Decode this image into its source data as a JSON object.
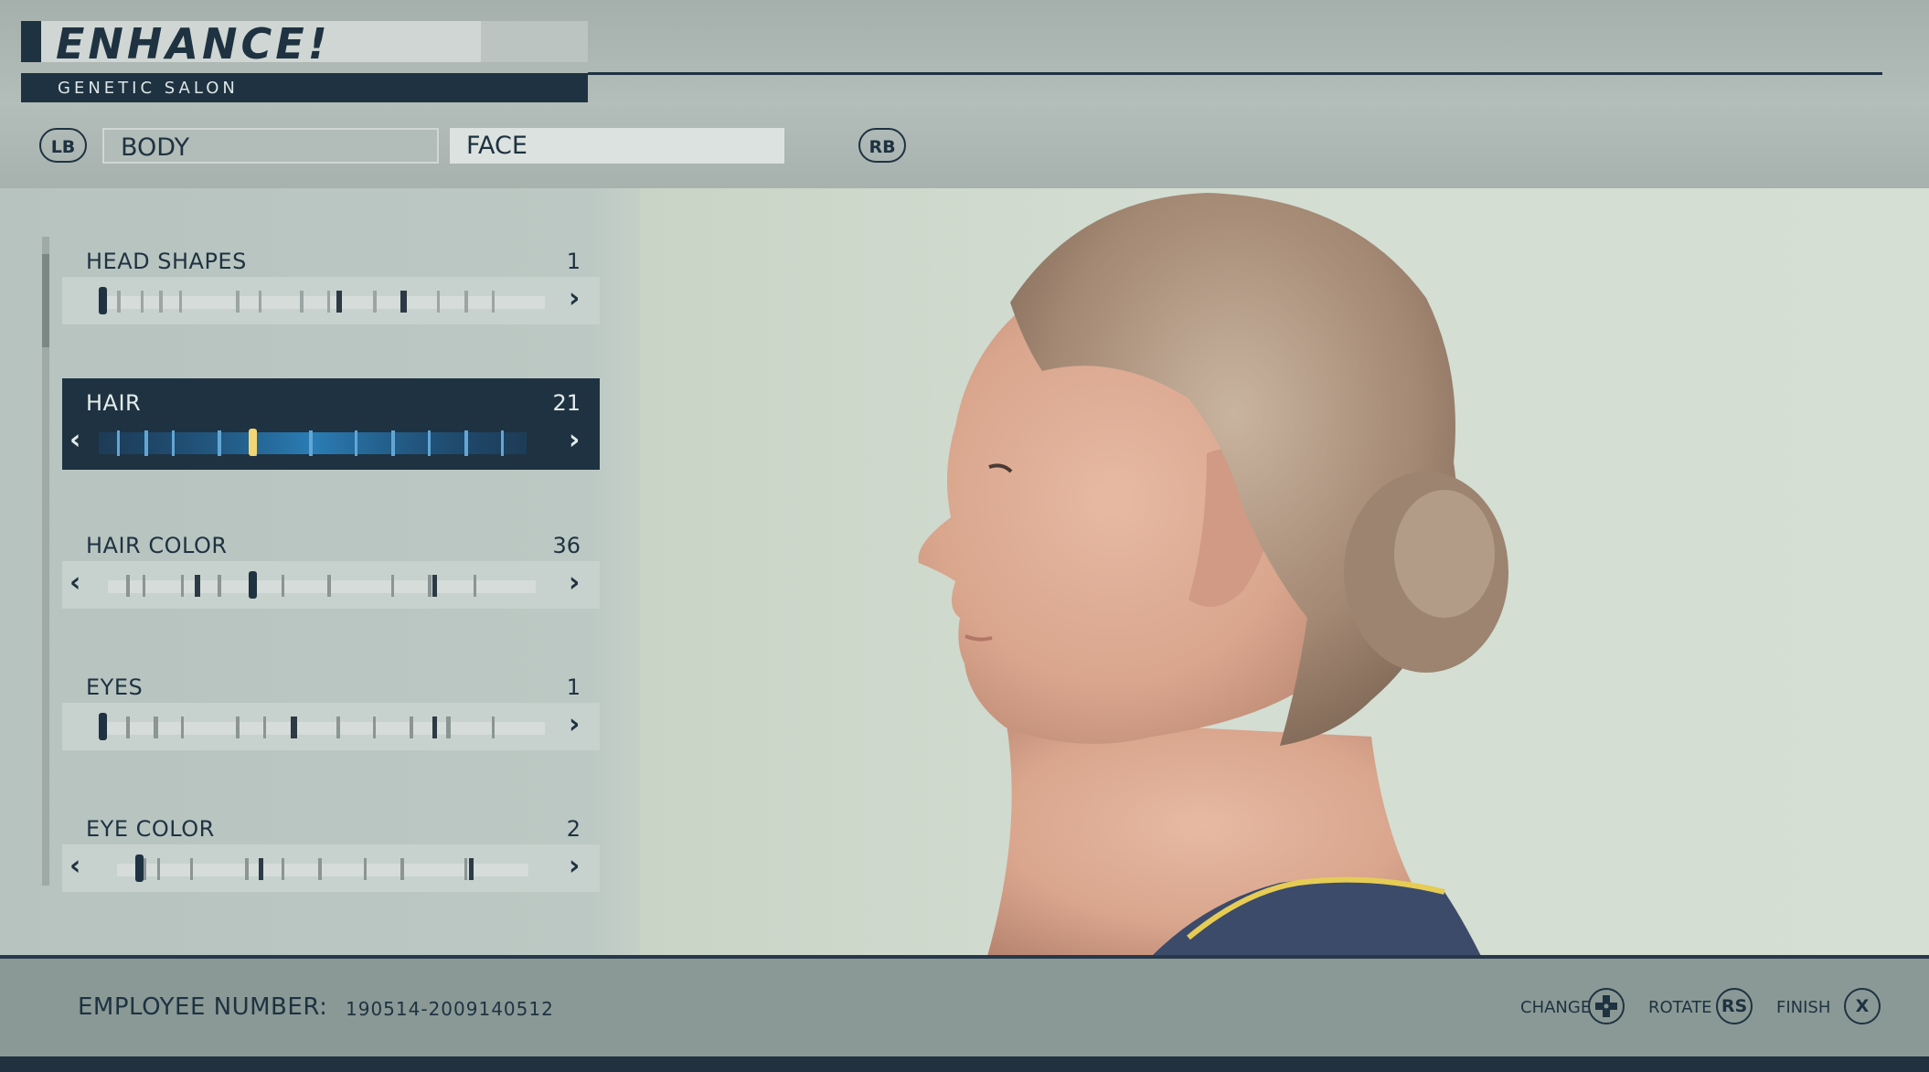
{
  "header": {
    "logo": "ENHANCE!",
    "subtitle": "GENETIC SALON"
  },
  "tabs": {
    "prev_button": "LB",
    "next_button": "RB",
    "items": [
      {
        "label": "BODY",
        "selected": false
      },
      {
        "label": "FACE",
        "selected": true
      }
    ]
  },
  "options": [
    {
      "label": "HEAD SHAPES",
      "value": "1"
    },
    {
      "label": "HAIR",
      "value": "21",
      "selected": true
    },
    {
      "label": "HAIR COLOR",
      "value": "36"
    },
    {
      "label": "EYES",
      "value": "1"
    },
    {
      "label": "EYE COLOR",
      "value": "2"
    }
  ],
  "footer": {
    "employee_label": "EMPLOYEE NUMBER:",
    "employee_number": "190514-2009140512",
    "hints": [
      {
        "label": "CHANGE",
        "button": "dpad"
      },
      {
        "label": "ROTATE",
        "button": "RS"
      },
      {
        "label": "FINISH",
        "button": "X"
      }
    ]
  },
  "colors": {
    "navy": "#1e3241",
    "selection_glow": "#2a7db5",
    "highlight": "#f2d675"
  }
}
